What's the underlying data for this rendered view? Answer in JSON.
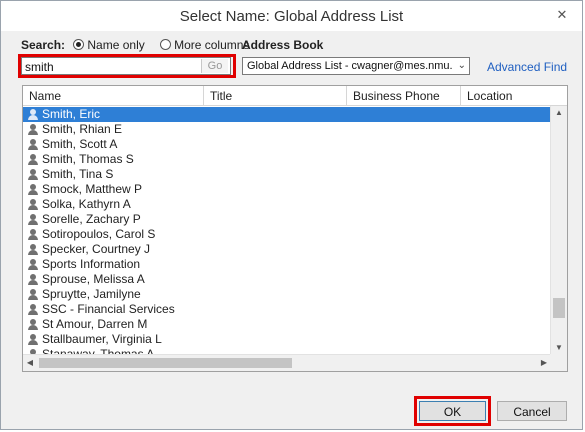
{
  "window": {
    "title": "Select Name: Global Address List",
    "close_glyph": "✕"
  },
  "search": {
    "label": "Search:",
    "option_name_only": "Name only",
    "option_more_columns": "More columns",
    "selected_option": "Name only",
    "value": "smith",
    "go_label": "Go"
  },
  "address_book": {
    "label": "Address Book",
    "selected": "Global Address List - cwagner@mes.nmu.e",
    "dropdown_glyph": "⌄",
    "advanced_find": "Advanced Find"
  },
  "list": {
    "columns": [
      "Name",
      "Title",
      "Business Phone",
      "Location"
    ],
    "rows": [
      {
        "name": "Smith, Eric",
        "selected": true
      },
      {
        "name": "Smith, Rhian E"
      },
      {
        "name": "Smith, Scott A"
      },
      {
        "name": "Smith, Thomas S"
      },
      {
        "name": "Smith, Tina S"
      },
      {
        "name": "Smock, Matthew P"
      },
      {
        "name": "Solka, Kathyrn A"
      },
      {
        "name": "Sorelle, Zachary P"
      },
      {
        "name": "Sotiropoulos, Carol S"
      },
      {
        "name": "Specker, Courtney J"
      },
      {
        "name": "Sports Information"
      },
      {
        "name": "Sprouse, Melissa A"
      },
      {
        "name": "Spruytte, Jamilyne"
      },
      {
        "name": "SSC - Financial Services"
      },
      {
        "name": "St Amour, Darren M"
      },
      {
        "name": "Stallbaumer, Virginia L"
      },
      {
        "name": "Stanaway, Thomas A"
      }
    ],
    "scroll_up_glyph": "▲",
    "scroll_down_glyph": "▼",
    "scroll_left_glyph": "◀",
    "scroll_right_glyph": "▶"
  },
  "footer": {
    "ok_label": "OK",
    "cancel_label": "Cancel"
  },
  "colors": {
    "selection": "#2e7fd6",
    "highlight_box": "#e00000",
    "link": "#1f5fc1"
  }
}
